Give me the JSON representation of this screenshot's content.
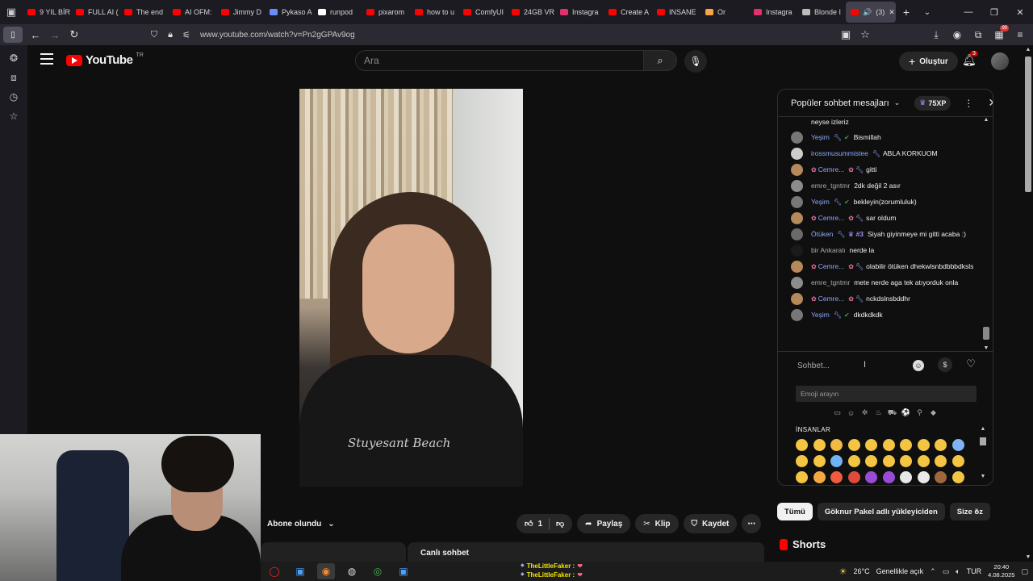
{
  "browser": {
    "tabs": [
      {
        "label": "9 YIL BİR",
        "color": "#ff0000"
      },
      {
        "label": "FULL AI (",
        "color": "#ff0000"
      },
      {
        "label": "The end",
        "color": "#ff0000"
      },
      {
        "label": "AI OFM:",
        "color": "#ff0000"
      },
      {
        "label": "Jimmy D",
        "color": "#ff0000"
      },
      {
        "label": "Pykaso A",
        "color": "#6b8cff"
      },
      {
        "label": "runpod",
        "color": "#ffffff"
      },
      {
        "label": "pixarom",
        "color": "#ff0000"
      },
      {
        "label": "how to u",
        "color": "#ff0000"
      },
      {
        "label": "ComfyUI",
        "color": "#ff0000"
      },
      {
        "label": "24GB VR",
        "color": "#ff0000"
      },
      {
        "label": "Instagra",
        "color": "#e1306c"
      },
      {
        "label": "Create A",
        "color": "#ff0000"
      },
      {
        "label": "INSANE",
        "color": "#ff0000"
      },
      {
        "label": "Or",
        "color": "#f4a742"
      },
      {
        "label": "Instagra",
        "color": "#e1306c"
      },
      {
        "label": "Blonde I",
        "color": "#bbbbbb"
      }
    ],
    "active_tab": {
      "label": "(3)",
      "color": "#ff0000"
    },
    "url": "www.youtube.com/watch?v=Pn2gGPAv9og",
    "extension_badge": "90"
  },
  "youtube": {
    "logo_text": "YouTube",
    "region": "TR",
    "search_placeholder": "Ara",
    "create_label": "Oluştur",
    "notification_count": "3",
    "subscribe_label": "Abone olundu",
    "like_count": "1",
    "share_label": "Paylaş",
    "clip_label": "Klip",
    "save_label": "Kaydet",
    "live_chat_label": "Canlı sohbet",
    "shirt_print": "Stuyesant Beach"
  },
  "chat": {
    "title": "Popüler sohbet mesajları",
    "xp": "75XP",
    "first_line": "neyse izleriz",
    "messages": [
      {
        "author": "Yeşim",
        "member": true,
        "tool": true,
        "check": true,
        "flowers": false,
        "rank": "",
        "text": "Bismillah",
        "avatar": "#777777"
      },
      {
        "author": "irossmusummistee",
        "member": true,
        "tool": true,
        "check": false,
        "flowers": false,
        "rank": "",
        "text": "ABLA KORKUOM",
        "avatar": "#cccccc"
      },
      {
        "author": "Cemre...",
        "member": true,
        "tool": true,
        "check": false,
        "flowers": true,
        "rank": "",
        "text": "gitti",
        "avatar": "#b5895a"
      },
      {
        "author": "emre_tgntmr",
        "member": false,
        "tool": false,
        "check": false,
        "flowers": false,
        "rank": "",
        "text": "2dk değil 2 asır",
        "avatar": "#8c8c8c"
      },
      {
        "author": "Yeşim",
        "member": true,
        "tool": true,
        "check": true,
        "flowers": false,
        "rank": "",
        "text": "bekleyin(zorumluluk)",
        "avatar": "#777777"
      },
      {
        "author": "Cemre...",
        "member": true,
        "tool": true,
        "check": false,
        "flowers": true,
        "rank": "",
        "text": "sar oldum",
        "avatar": "#b5895a"
      },
      {
        "author": "Ötüken",
        "member": true,
        "tool": true,
        "check": false,
        "flowers": false,
        "rank": "#3",
        "text": "Siyah giyinmeye mi gitti acaba :)",
        "avatar": "#6a6a6a"
      },
      {
        "author": "bir Ankaralı",
        "member": false,
        "tool": false,
        "check": false,
        "flowers": false,
        "rank": "",
        "text": "nerde la",
        "avatar": "#1a1a1a"
      },
      {
        "author": "Cemre...",
        "member": true,
        "tool": true,
        "check": false,
        "flowers": true,
        "rank": "",
        "text": "olabilir ötüken dhekwlsnbdbbbdksls",
        "avatar": "#b5895a"
      },
      {
        "author": "emre_tgntmr",
        "member": false,
        "tool": false,
        "check": false,
        "flowers": false,
        "rank": "",
        "text": "mete nerde aga tek atıyorduk onla",
        "avatar": "#8c8c8c"
      },
      {
        "author": "Cemre...",
        "member": true,
        "tool": true,
        "check": false,
        "flowers": true,
        "rank": "",
        "text": "nckdslnsbddhr",
        "avatar": "#b5895a"
      },
      {
        "author": "Yeşim",
        "member": true,
        "tool": true,
        "check": true,
        "flowers": false,
        "rank": "",
        "text": "dkdkdkdk",
        "avatar": "#777777"
      }
    ],
    "input_placeholder": "Sohbet...",
    "emoji_search_placeholder": "Emoji arayın",
    "emoji_section": "İNSANLAR"
  },
  "chips": [
    "Tümü",
    "Göknur Pakel adlı yükleyiciden",
    "Size öz"
  ],
  "shorts_title": "Shorts",
  "taskbar": {
    "overlay_chat": [
      {
        "name": "TheLittleFaker :",
        "heart": "❤"
      },
      {
        "name": "TheLittleFaker :",
        "heart": "❤"
      }
    ],
    "weather": "26°C",
    "weather_desc": "Genellikle açık",
    "lang": "TUR",
    "time": "20:40",
    "date": "4.08.2025"
  }
}
